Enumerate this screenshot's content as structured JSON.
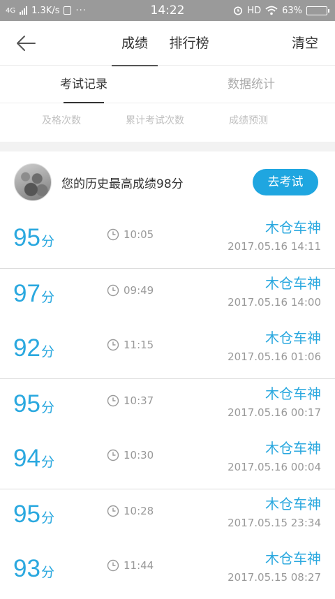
{
  "status_bar": {
    "network_type": "4G",
    "speed": "1.3K/s",
    "dots": "···",
    "time": "14:22",
    "hd": "HD",
    "battery": "63%",
    "battery_level": 0.63
  },
  "nav": {
    "tabs": [
      {
        "label": "成绩"
      },
      {
        "label": "排行榜"
      }
    ],
    "clear_label": "清空"
  },
  "subtabs": [
    {
      "label": "考试记录"
    },
    {
      "label": "数据统计"
    }
  ],
  "stat_labels": [
    "及格次数",
    "累计考试次数",
    "成绩预测"
  ],
  "best": {
    "text": "您的历史最高成绩98分",
    "button_label": "去考试"
  },
  "records": [
    {
      "score": "95",
      "unit": "分",
      "duration": "10:05",
      "name": "木仓车神",
      "date": "2017.05.16  14:11"
    },
    {
      "score": "97",
      "unit": "分",
      "duration": "09:49",
      "name": "木仓车神",
      "date": "2017.05.16  14:00"
    },
    {
      "score": "92",
      "unit": "分",
      "duration": "11:15",
      "name": "木仓车神",
      "date": "2017.05.16  01:06"
    },
    {
      "score": "95",
      "unit": "分",
      "duration": "10:37",
      "name": "木仓车神",
      "date": "2017.05.16  00:17"
    },
    {
      "score": "94",
      "unit": "分",
      "duration": "10:30",
      "name": "木仓车神",
      "date": "2017.05.16  00:04"
    },
    {
      "score": "95",
      "unit": "分",
      "duration": "10:28",
      "name": "木仓车神",
      "date": "2017.05.15  23:34"
    },
    {
      "score": "93",
      "unit": "分",
      "duration": "11:44",
      "name": "木仓车神",
      "date": "2017.05.15  08:27"
    }
  ],
  "colors": {
    "accent": "#2aa8df",
    "button": "#1fa6e0",
    "status_bar": "#9a9a9a"
  },
  "icons": [
    "back-arrow-icon",
    "clock-icon",
    "signal-icon",
    "alarm-icon",
    "wifi-icon",
    "battery-icon"
  ]
}
